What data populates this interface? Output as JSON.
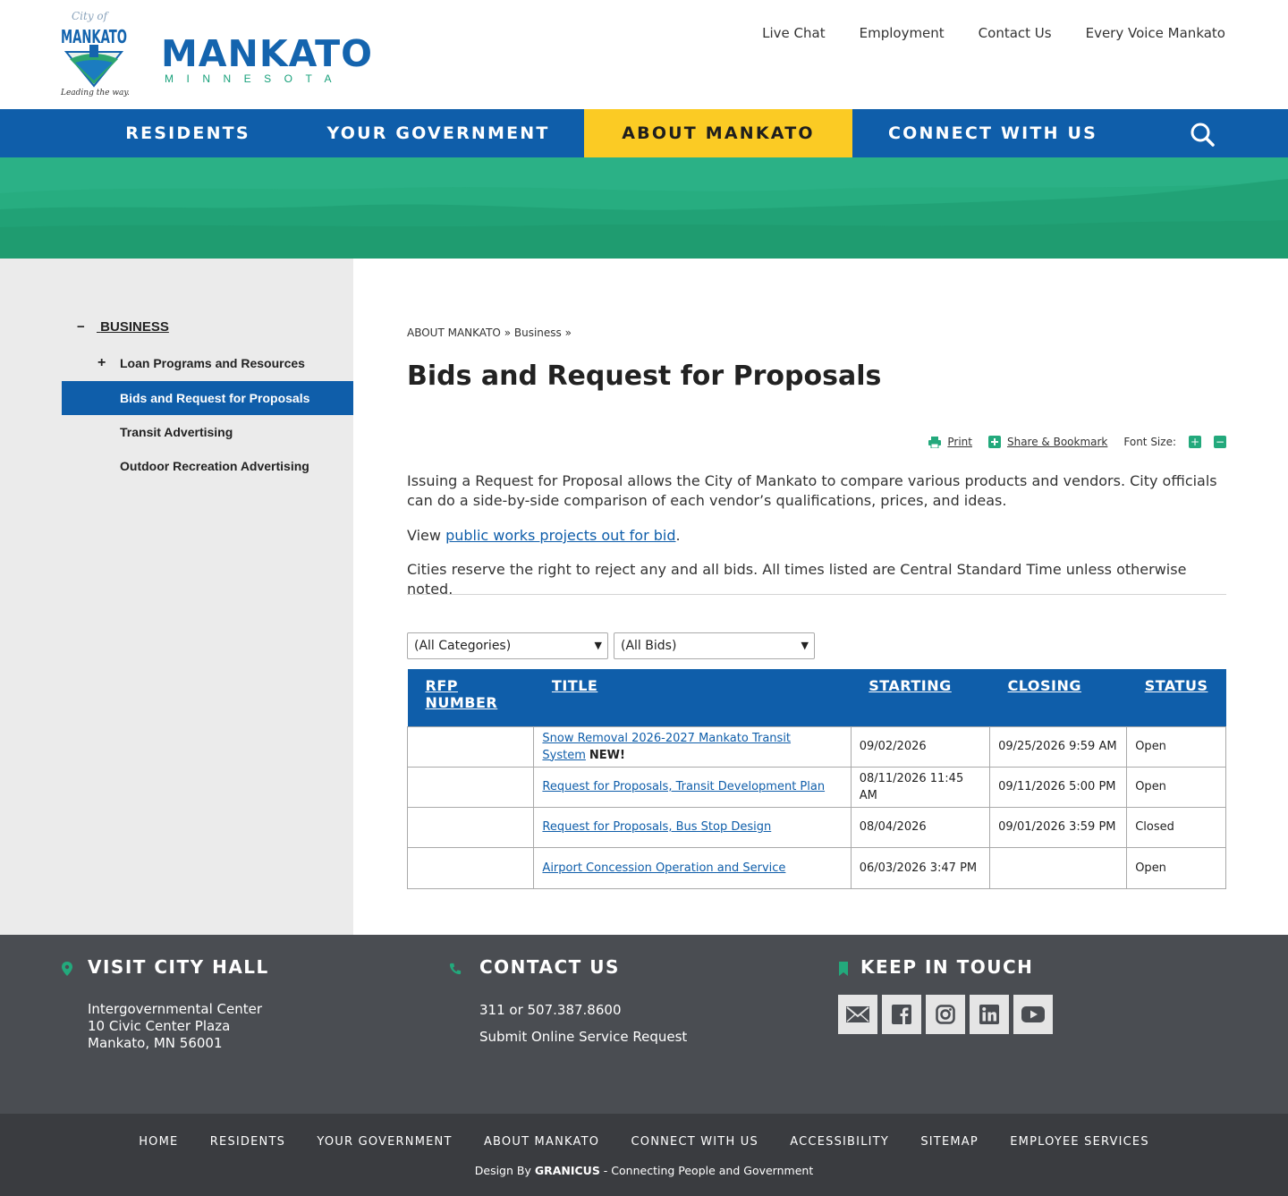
{
  "brand": {
    "seal_script": "City of",
    "seal_name": "MANKATO",
    "seal_tagline": "Leading the way...",
    "wordmark_main": "MANKATO",
    "wordmark_sub": "MINNESOTA"
  },
  "utility_nav": [
    "Live Chat",
    "Employment",
    "Contact Us",
    "Every Voice Mankato"
  ],
  "main_nav": {
    "items": [
      "RESIDENTS",
      "YOUR GOVERNMENT",
      "ABOUT MANKATO",
      "CONNECT WITH US"
    ],
    "active": "ABOUT MANKATO",
    "search_icon": "search-icon"
  },
  "sidebar": {
    "top": {
      "sign": "−",
      "label": "BUSINESS"
    },
    "items": [
      {
        "sign": "+",
        "label": "Loan Programs and Resources"
      },
      {
        "sign": "",
        "label": "Bids and Request for Proposals",
        "current": true
      },
      {
        "sign": "",
        "label": "Transit Advertising"
      },
      {
        "sign": "",
        "label": "Outdoor Recreation Advertising"
      }
    ]
  },
  "breadcrumb": {
    "parts": [
      "ABOUT MANKATO",
      "»",
      "Business",
      "»"
    ]
  },
  "page_title": "Bids and Request for Proposals",
  "tools": {
    "print": "Print",
    "share": "Share & Bookmark",
    "font_size_label": "Font Size:",
    "increase": "+",
    "decrease": "−"
  },
  "paragraphs": {
    "intro": "Issuing a Request for Proposal allows the City of Mankato to compare various products and vendors. City officials can do a side-by-side comparison of each vendor’s qualifications, prices, and ideas.",
    "view_prefix": "View ",
    "view_link": "public works projects out for bid",
    "view_suffix": ".",
    "notice": "Cities reserve the right to reject any and all bids. All times listed are Central Standard Time unless otherwise noted."
  },
  "filters": {
    "category": "(All Categories)",
    "bids": "(All Bids)"
  },
  "table": {
    "headers": [
      "RFP NUMBER",
      "TITLE",
      "STARTING",
      "CLOSING",
      "STATUS"
    ],
    "rows": [
      {
        "rfp": "",
        "title": "Snow Removal 2026-2027 Mankato Transit System",
        "badge": "NEW!",
        "starting": "09/02/2026",
        "closing": "09/25/2026 9:59 AM",
        "status": "Open"
      },
      {
        "rfp": "",
        "title": "Request for Proposals, Transit Development Plan",
        "badge": "",
        "starting": "08/11/2026 11:45 AM",
        "closing": "09/11/2026 5:00 PM",
        "status": "Open"
      },
      {
        "rfp": "",
        "title": "Request for Proposals, Bus Stop Design",
        "badge": "",
        "starting": "08/04/2026",
        "closing": "09/01/2026 3:59 PM",
        "status": "Closed"
      },
      {
        "rfp": "",
        "title": "Airport Concession Operation and Service",
        "badge": "",
        "starting": "06/03/2026 3:47 PM",
        "closing": "",
        "status": "Open"
      }
    ]
  },
  "footer": {
    "visit": {
      "heading": "VISIT CITY HALL",
      "lines": [
        "Intergovernmental Center",
        "10 Civic Center Plaza",
        "Mankato, MN 56001"
      ]
    },
    "contact": {
      "heading": "CONTACT US",
      "phone": "311 or 507.387.8600",
      "request": "Submit Online Service Request"
    },
    "keep": {
      "heading": "KEEP IN TOUCH",
      "social": [
        "email-icon",
        "facebook-icon",
        "instagram-icon",
        "linkedin-icon",
        "youtube-icon"
      ]
    },
    "accent_color": "#23a97c"
  },
  "bottom_links": [
    "HOME",
    "RESIDENTS",
    "YOUR GOVERNMENT",
    "ABOUT MANKATO",
    "CONNECT WITH US",
    "ACCESSIBILITY",
    "SITEMAP",
    "EMPLOYEE SERVICES"
  ],
  "credit": {
    "prefix": "Design By ",
    "brand": "GRANICUS",
    "suffix": " - Connecting People and Government"
  },
  "colors": {
    "primary_blue": "#0f5eaa",
    "active_yellow": "#fbcb24",
    "green": "#23a97c",
    "footer_gray": "#4a4d52"
  }
}
